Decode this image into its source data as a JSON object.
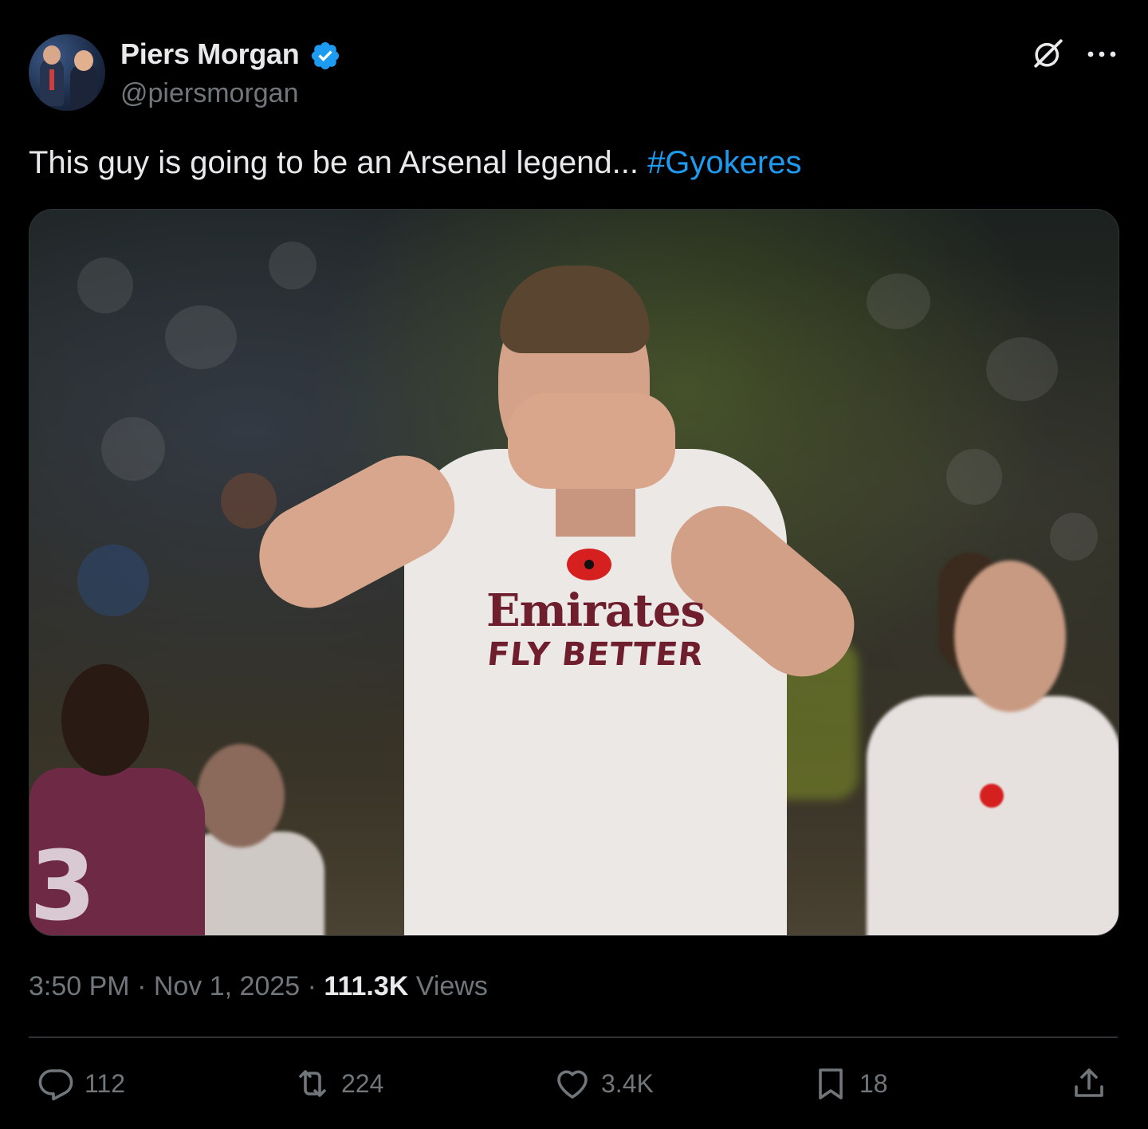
{
  "author": {
    "name": "Piers Morgan",
    "handle": "@piersmorgan",
    "verified": true,
    "verified_color": "#1d9bf0"
  },
  "header_icons": [
    "grok-icon",
    "more-icon"
  ],
  "tweet": {
    "text": "This guy is going to be an Arsenal legend... ",
    "hashtag": "#Gyokeres"
  },
  "media": {
    "shirt_sponsor_line1": "Emirates",
    "shirt_sponsor_line2": "FLY BETTER",
    "opponent_number": "3"
  },
  "meta": {
    "time": "3:50 PM",
    "separator": " · ",
    "date": "Nov 1, 2025",
    "views_count": "111.3K",
    "views_label": " Views"
  },
  "actions": {
    "replies": "112",
    "reposts": "224",
    "likes": "3.4K",
    "bookmarks": "18"
  },
  "colors": {
    "background": "#000000",
    "text": "#e7e9ea",
    "secondary": "#71767b",
    "link": "#1d9bf0"
  }
}
